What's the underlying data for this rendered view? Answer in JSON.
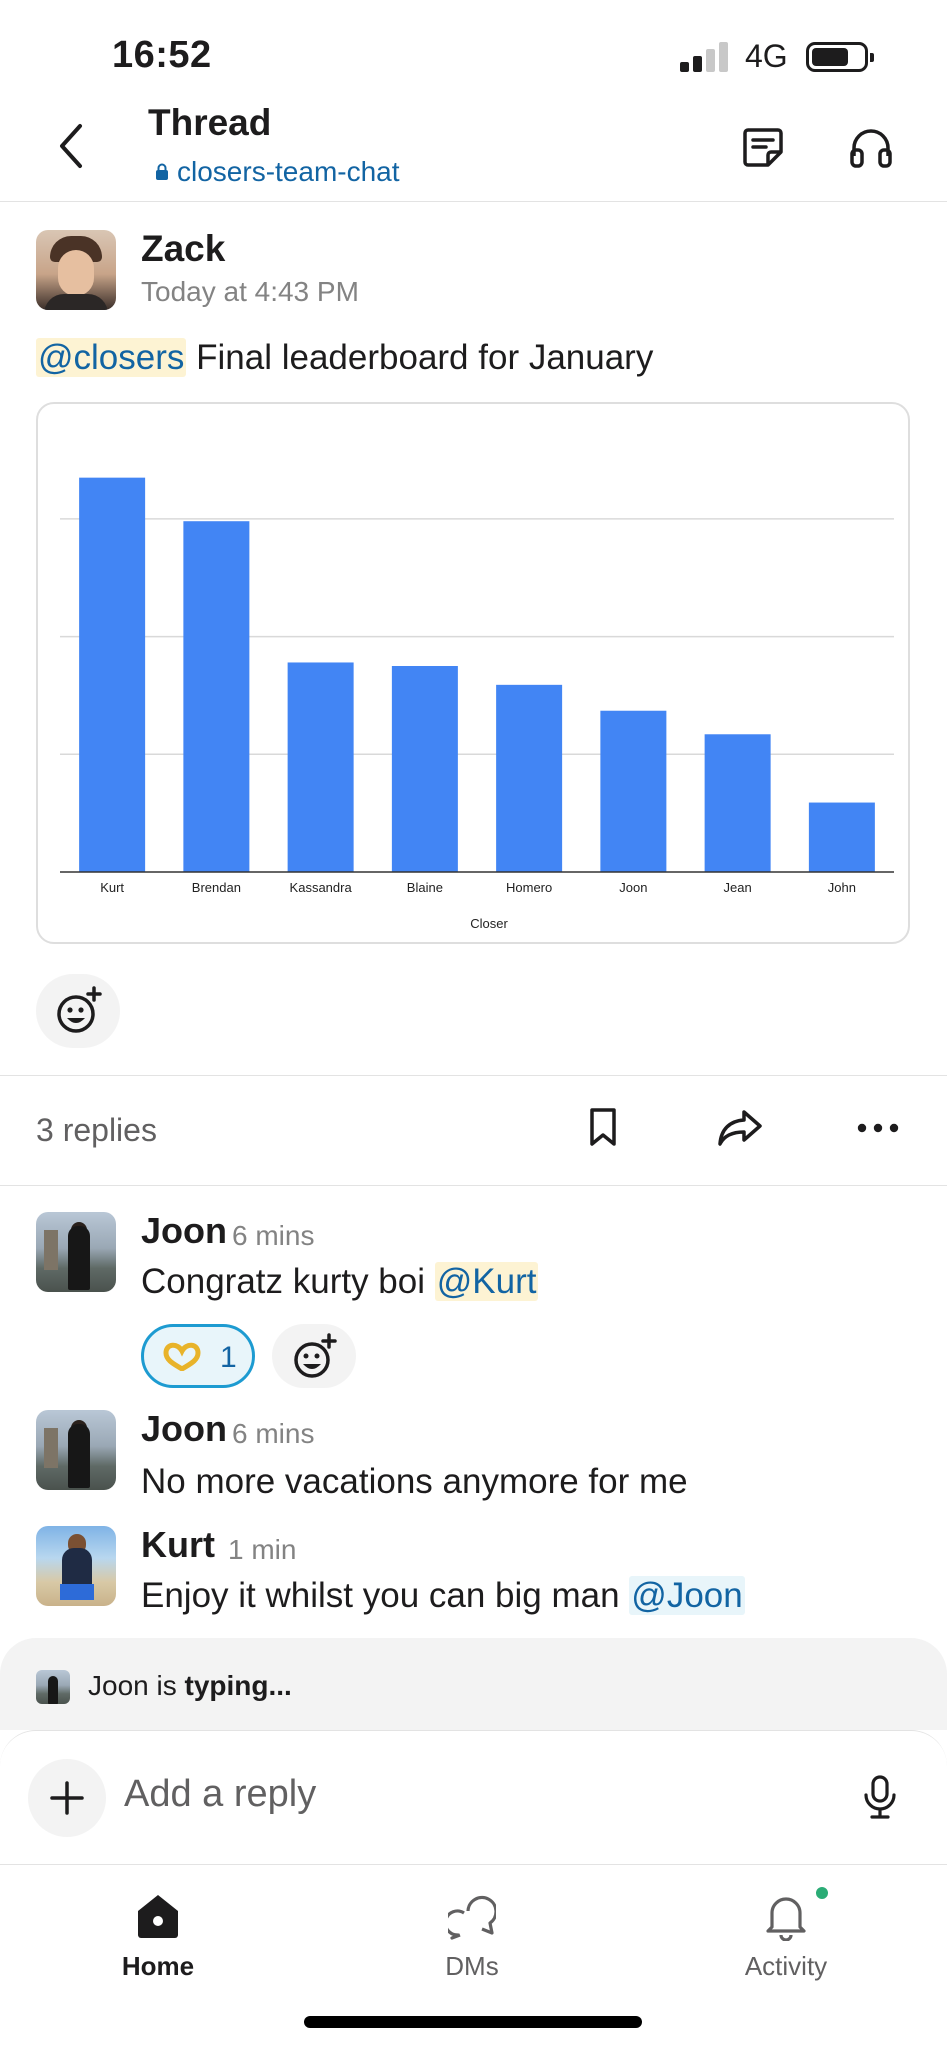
{
  "status_bar": {
    "time": "16:52",
    "network": "4G"
  },
  "header": {
    "title": "Thread",
    "channel": "closers-team-chat"
  },
  "parent_message": {
    "author": "Zack",
    "timestamp": "Today at 4:43 PM",
    "mention": "@closers",
    "text": " Final leaderboard for January"
  },
  "chart_data": {
    "type": "bar",
    "categories": [
      "Kurt",
      "Brendan",
      "Kassandra",
      "Blaine",
      "Homero",
      "Joon",
      "Jean",
      "John"
    ],
    "values": [
      33.5,
      29.8,
      17.8,
      17.5,
      15.9,
      13.7,
      11.7,
      5.9
    ],
    "xlabel": "Closer",
    "ylabel": "",
    "ylim": [
      0,
      35
    ],
    "grid": true,
    "color": "#4285f4"
  },
  "thread_actions": {
    "replies_count": "3 replies"
  },
  "replies": [
    {
      "author": "Joon",
      "time": "6 mins",
      "text": "Congratz kurty boi ",
      "mention": "@Kurt",
      "reaction_count": "1"
    },
    {
      "author": "Joon",
      "time": "6 mins",
      "text": "No more vacations anymore for me"
    },
    {
      "author": "Kurt",
      "time": "1 min",
      "text": "Enjoy it whilst you can big man ",
      "mention": "@Joon"
    }
  ],
  "typing": {
    "user": "Joon is ",
    "status": "typing..."
  },
  "composer": {
    "placeholder": "Add a reply"
  },
  "tab_bar": {
    "home": "Home",
    "dms": "DMs",
    "activity": "Activity"
  },
  "colors": {
    "accent": "#1264a3",
    "bar": "#4285f4",
    "online": "#2bac76"
  }
}
